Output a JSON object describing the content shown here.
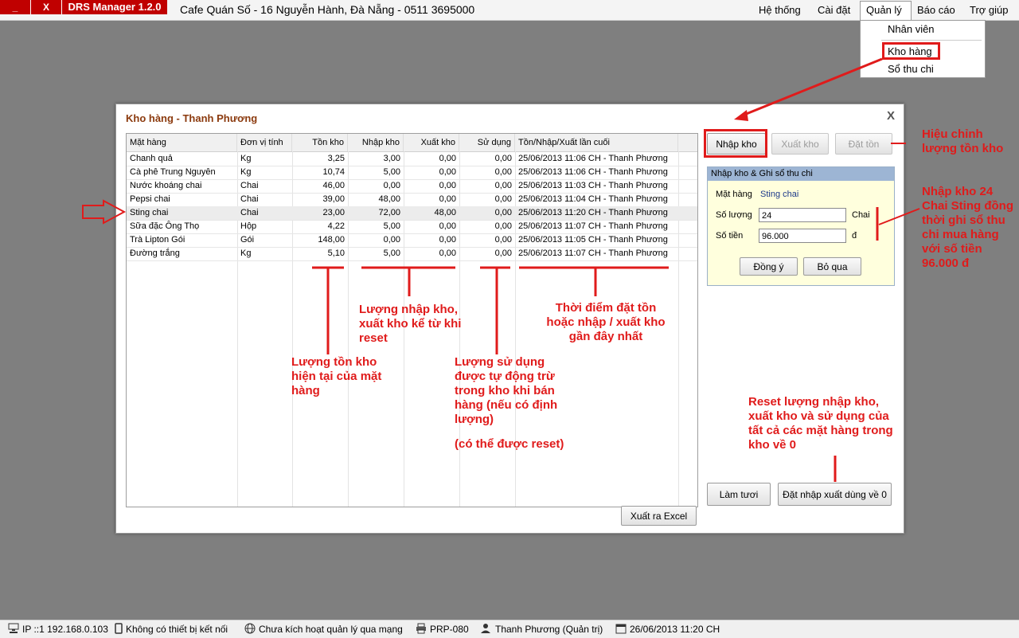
{
  "app": {
    "title": "DRS Manager 1.2.0",
    "minimize_label": "_",
    "close_label": "X",
    "store_info": "Cafe Quán Số  -  16 Nguyễn Hành, Đà Nẵng  -  0511 3695000"
  },
  "menu": {
    "items": [
      "Hệ thống",
      "Cài đặt",
      "Quản lý",
      "Báo cáo",
      "Trợ giúp"
    ],
    "dropdown": [
      "Nhân viên",
      "Kho hàng",
      "Sổ thu chi"
    ]
  },
  "dialog": {
    "title": "Kho hàng - Thanh Phương",
    "close": "X",
    "columns": [
      "Mặt hàng",
      "Đơn vị tính",
      "Tồn kho",
      "Nhập kho",
      "Xuất kho",
      "Sử dụng",
      "Tồn/Nhập/Xuất lần cuối"
    ],
    "rows": [
      [
        "Chanh quả",
        "Kg",
        "3,25",
        "3,00",
        "0,00",
        "0,00",
        "25/06/2013 11:06 CH - Thanh Phương"
      ],
      [
        "Cà phê Trung Nguyên",
        "Kg",
        "10,74",
        "5,00",
        "0,00",
        "0,00",
        "25/06/2013 11:06 CH - Thanh Phương"
      ],
      [
        "Nước khoáng chai",
        "Chai",
        "46,00",
        "0,00",
        "0,00",
        "0,00",
        "25/06/2013 11:03 CH - Thanh Phương"
      ],
      [
        "Pepsi chai",
        "Chai",
        "39,00",
        "48,00",
        "0,00",
        "0,00",
        "25/06/2013 11:04 CH - Thanh Phương"
      ],
      [
        "Sting chai",
        "Chai",
        "23,00",
        "72,00",
        "48,00",
        "0,00",
        "25/06/2013 11:20 CH - Thanh Phương"
      ],
      [
        "Sữa đặc Ông Thọ",
        "Hộp",
        "4,22",
        "5,00",
        "0,00",
        "0,00",
        "25/06/2013 11:07 CH - Thanh Phương"
      ],
      [
        "Trà Lipton Gói",
        "Gói",
        "148,00",
        "0,00",
        "0,00",
        "0,00",
        "25/06/2013 11:05 CH - Thanh Phương"
      ],
      [
        "Đường trắng",
        "Kg",
        "5,10",
        "5,00",
        "0,00",
        "0,00",
        "25/06/2013 11:07 CH - Thanh Phương"
      ]
    ],
    "btn_import": "Nhập kho",
    "btn_export": "Xuất kho",
    "btn_set": "Đặt tồn",
    "btn_excel": "Xuất ra Excel",
    "btn_refresh": "Làm tươi",
    "btn_reset": "Đặt nhập xuất dùng về 0",
    "panel": {
      "title": "Nhập kho & Ghi sổ thu chi",
      "item_label": "Mặt hàng",
      "item_value": "Sting chai",
      "qty_label": "Số lượng",
      "qty_value": "24",
      "qty_unit": "Chai",
      "amount_label": "Số tiền",
      "amount_value": "96.000",
      "amount_unit": "đ",
      "ok": "Đồng ý",
      "cancel": "Bỏ qua"
    }
  },
  "annotations": {
    "adjust": "Hiệu chỉnh lượng tồn kho",
    "import_note": "Nhập kho 24 Chai Sting đồng thời ghi sổ thu chi mua hàng với số tiền 96.000 đ",
    "stock_note": "Lượng tồn kho hiện tại của mặt hàng",
    "inout_note": "Lượng nhập kho, xuất kho kể từ khi reset",
    "time_note": "Thời điểm đặt tồn hoặc nhập / xuất kho gần đây nhất",
    "usage_note": "Lượng sử dụng được tự động trừ trong kho khi bán hàng (nếu có định lượng)",
    "usage_note2": "(có thể được reset)",
    "reset_note": "Reset lượng nhập kho, xuất kho và sử dụng của tất cả các mặt hàng trong kho về 0"
  },
  "status": {
    "ip": "IP ::1 192.168.0.103",
    "device": "Không có thiết bị kết nối",
    "network": "Chưa kích hoạt quản lý qua mạng",
    "printer": "PRP-080",
    "user": "Thanh Phương (Quản trị)",
    "datetime": "26/06/2013 11:20 CH"
  },
  "colors": {
    "accent": "#c00000",
    "annotation": "#e01b1b",
    "panel_bg": "#ffffdd"
  }
}
